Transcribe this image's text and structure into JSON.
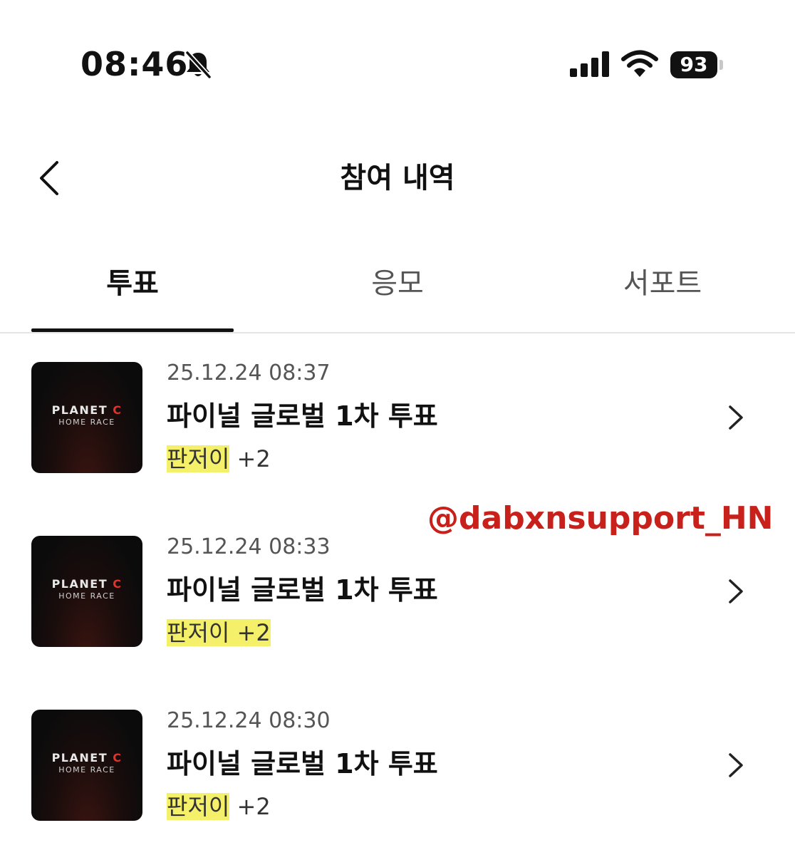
{
  "status_bar": {
    "time": "08:46",
    "battery": "93"
  },
  "header": {
    "title": "참여 내역"
  },
  "tabs": [
    {
      "label": "투표",
      "active": true
    },
    {
      "label": "응모",
      "active": false
    },
    {
      "label": "서포트",
      "active": false
    }
  ],
  "thumbnail": {
    "logo_main": "PLANET",
    "logo_c": "C",
    "logo_sub": "HOME RACE"
  },
  "items": [
    {
      "date": "25.12.24 08:37",
      "title": "파이널 글로벌 1차 투표",
      "tag_name": "판저이",
      "tag_extra": "+2"
    },
    {
      "date": "25.12.24 08:33",
      "title": "파이널 글로벌 1차 투표",
      "tag_name": "판저이",
      "tag_extra": "+2"
    },
    {
      "date": "25.12.24 08:30",
      "title": "파이널 글로벌 1차 투표",
      "tag_name": "판저이",
      "tag_extra": "+2"
    }
  ],
  "watermark": "@dabxnsupport_HN",
  "colors": {
    "highlight": "#f5f06a",
    "watermark": "#c8201a",
    "text_primary": "#111111",
    "text_secondary": "#555555"
  },
  "icons": [
    "bell-slash-icon",
    "signal-icon",
    "wifi-icon",
    "battery-icon",
    "back-chevron-icon",
    "chevron-right-icon"
  ]
}
